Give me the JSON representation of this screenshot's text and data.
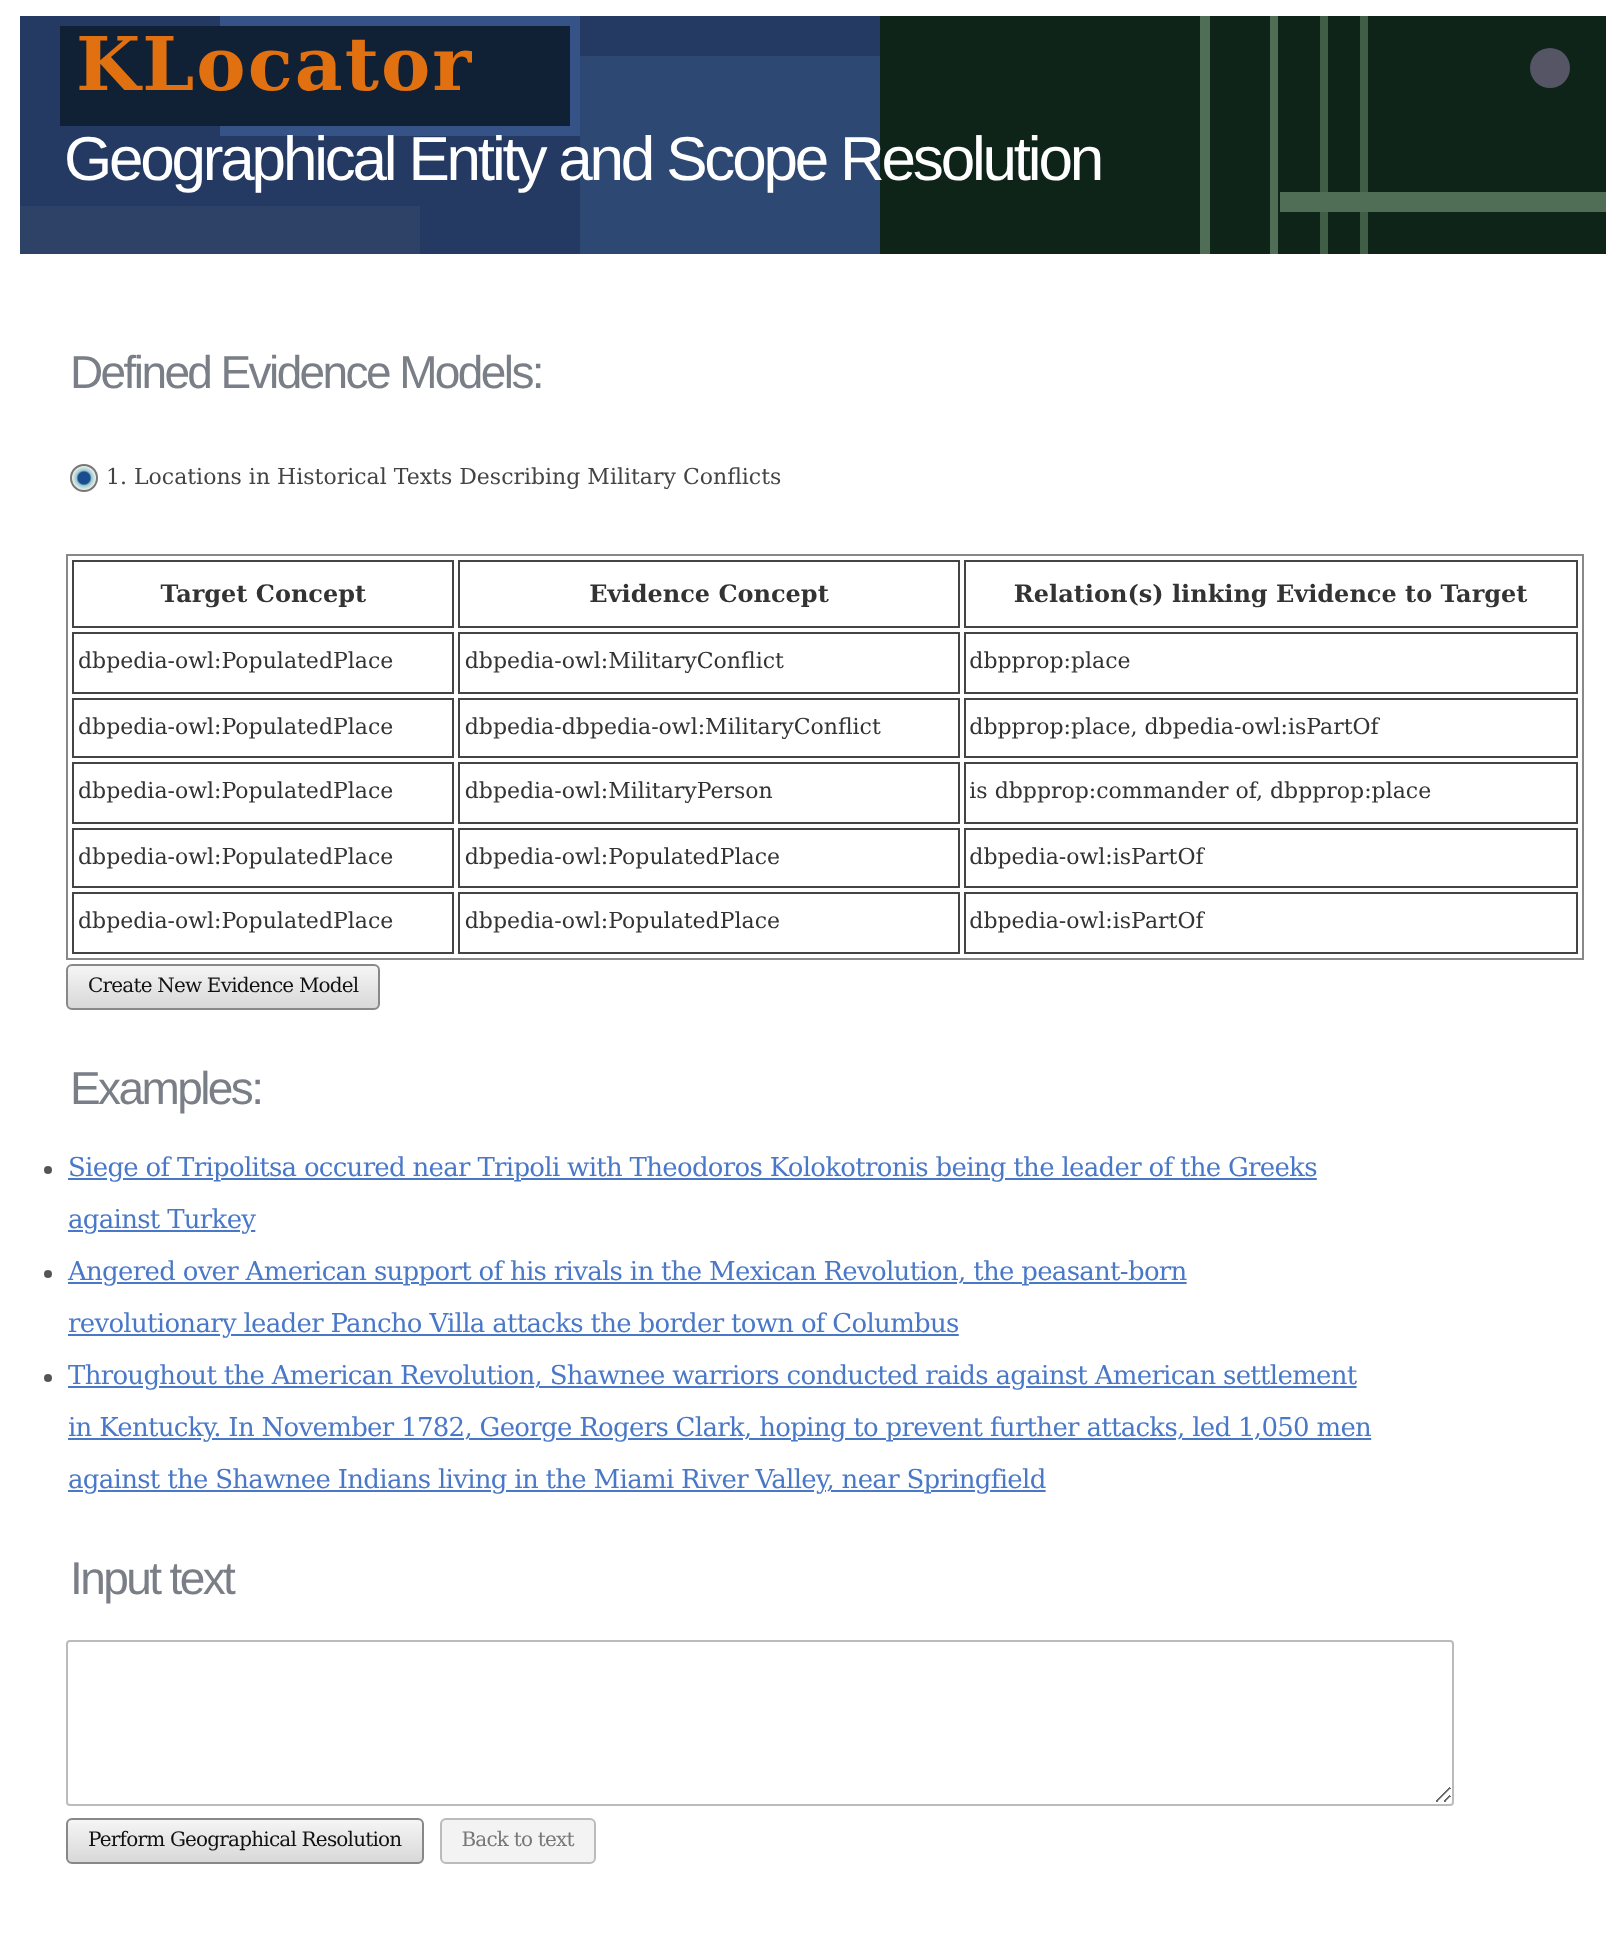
{
  "header": {
    "logo": "KLocator",
    "subtitle": "Geographical Entity and Scope Resolution"
  },
  "models_section": {
    "heading": "Defined Evidence Models:",
    "models": [
      {
        "label": "1. Locations in Historical Texts Describing Military Conflicts",
        "selected": true
      }
    ],
    "table": {
      "columns": [
        "Target Concept",
        "Evidence Concept",
        "Relation(s) linking Evidence to Target"
      ],
      "rows": [
        [
          "dbpedia-owl:PopulatedPlace",
          "dbpedia-owl:MilitaryConflict",
          "dbpprop:place"
        ],
        [
          "dbpedia-owl:PopulatedPlace",
          "dbpedia-dbpedia-owl:MilitaryConflict",
          "dbpprop:place, dbpedia-owl:isPartOf"
        ],
        [
          "dbpedia-owl:PopulatedPlace",
          "dbpedia-owl:MilitaryPerson",
          "is dbpprop:commander of, dbpprop:place"
        ],
        [
          "dbpedia-owl:PopulatedPlace",
          "dbpedia-owl:PopulatedPlace",
          "dbpedia-owl:isPartOf"
        ],
        [
          "dbpedia-owl:PopulatedPlace",
          "dbpedia-owl:PopulatedPlace",
          "dbpedia-owl:isPartOf"
        ]
      ]
    },
    "create_button": "Create New Evidence Model"
  },
  "examples_section": {
    "heading": "Examples:",
    "examples": [
      {
        "lines": [
          "Siege of Tripolitsa occured near Tripoli with Theodoros Kolokotronis being the leader of the Greeks",
          "against Turkey"
        ]
      },
      {
        "lines": [
          "Angered over American support of his rivals in the Mexican Revolution, the peasant-born",
          "revolutionary leader Pancho Villa attacks the border town of Columbus"
        ]
      },
      {
        "lines": [
          "Throughout the American Revolution, Shawnee warriors conducted raids against American settlement",
          "in Kentucky. In November 1782, George Rogers Clark, hoping to prevent further attacks, led 1,050 men",
          "against the Shawnee Indians living in the Miami River Valley, near Springfield"
        ]
      }
    ]
  },
  "input_section": {
    "heading": "Input text",
    "buttons": [
      {
        "label": "Perform Geographical Resolution",
        "disabled": false
      },
      {
        "label": "Back to text",
        "disabled": true
      }
    ]
  }
}
